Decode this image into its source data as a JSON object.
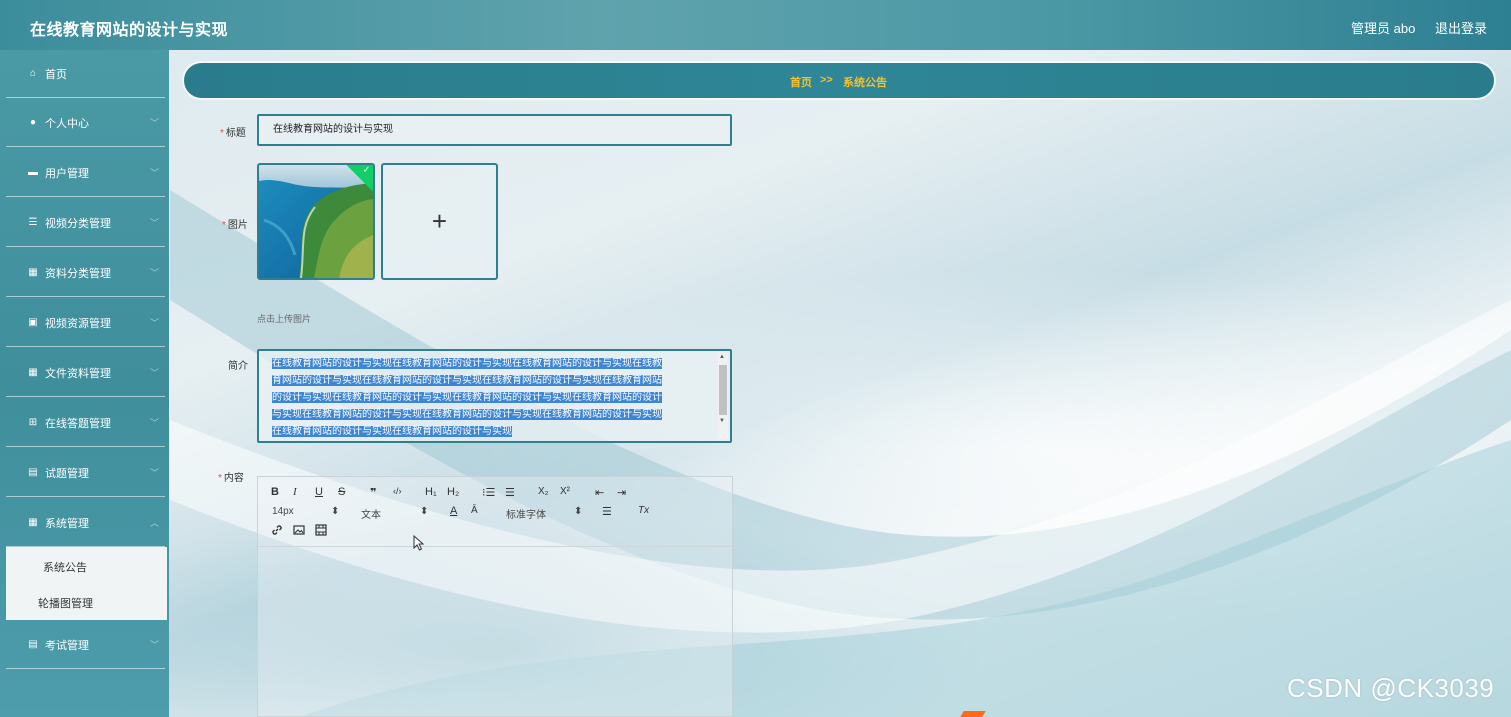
{
  "header": {
    "app_title": "在线教育网站的设计与实现",
    "admin_label": "管理员 abo",
    "logout_label": "退出登录"
  },
  "sidebar": {
    "items": [
      {
        "label": "首页",
        "icon": "home-icon",
        "glyph": "⌂"
      },
      {
        "label": "个人中心",
        "icon": "user-icon",
        "glyph": "●"
      },
      {
        "label": "用户管理",
        "icon": "monitor-icon",
        "glyph": "▬"
      },
      {
        "label": "视频分类管理",
        "icon": "sliders-icon",
        "glyph": "☰"
      },
      {
        "label": "资料分类管理",
        "icon": "grid-icon",
        "glyph": "▦"
      },
      {
        "label": "视频资源管理",
        "icon": "image-icon",
        "glyph": "▣"
      },
      {
        "label": "文件资料管理",
        "icon": "grid-icon",
        "glyph": "▦"
      },
      {
        "label": "在线答题管理",
        "icon": "grid-small-icon",
        "glyph": "⊞"
      },
      {
        "label": "试题管理",
        "icon": "clipboard-icon",
        "glyph": "▤"
      },
      {
        "label": "系统管理",
        "icon": "grid-icon",
        "glyph": "▦"
      },
      {
        "label": "考试管理",
        "icon": "clipboard-icon",
        "glyph": "▤"
      }
    ],
    "sub_items": [
      {
        "label": "系统公告"
      },
      {
        "label": "轮播图管理"
      }
    ]
  },
  "breadcrumb": {
    "home": "首页",
    "separator": ">>",
    "current": "系统公告"
  },
  "form": {
    "title_label": "标题",
    "title_value": "在线教育网站的设计与实现",
    "image_label": "图片",
    "upload_plus": "+",
    "upload_hint": "点击上传图片",
    "intro_label": "简介",
    "intro_lines": [
      "在线教育网站的设计与实现在线教育网站的设计与实现在线教育网站的设计与实现在线教",
      "育网站的设计与实现在线教育网站的设计与实现在线教育网站的设计与实现在线教育网站",
      "的设计与实现在线教育网站的设计与实现在线教育网站的设计与实现在线教育网站的设计",
      "与实现在线教育网站的设计与实现在线教育网站的设计与实现在线教育网站的设计与实现",
      "在线教育网站的设计与实现在线教育网站的设计与实现"
    ],
    "content_label": "内容",
    "required_mark": "*"
  },
  "editor": {
    "buttons": {
      "bold": "B",
      "italic": "I",
      "underline": "U",
      "strike": "S",
      "quote": "❞",
      "code": "‹/›",
      "h1": "H₁",
      "h2": "H₂",
      "ordered_list": "⁝☰",
      "bullet_list": "☰",
      "subscript": "X₂",
      "superscript": "X²",
      "outdent": "⇤",
      "indent": "⇥",
      "font_color": "A",
      "background": "Ā",
      "align": "☰",
      "clean": "Tx",
      "link": "🔗",
      "image": "▣",
      "video": "▤"
    },
    "size_value": "14px",
    "header_value": "文本",
    "font_value": "标准字体",
    "select_arrow": "⬍"
  },
  "watermark": "CSDN @CK3039",
  "colors": {
    "accent": "#2f7f8f",
    "breadcrumb_text": "#f2c230",
    "selection": "#3d86d6",
    "upload_success": "#13ce66"
  }
}
